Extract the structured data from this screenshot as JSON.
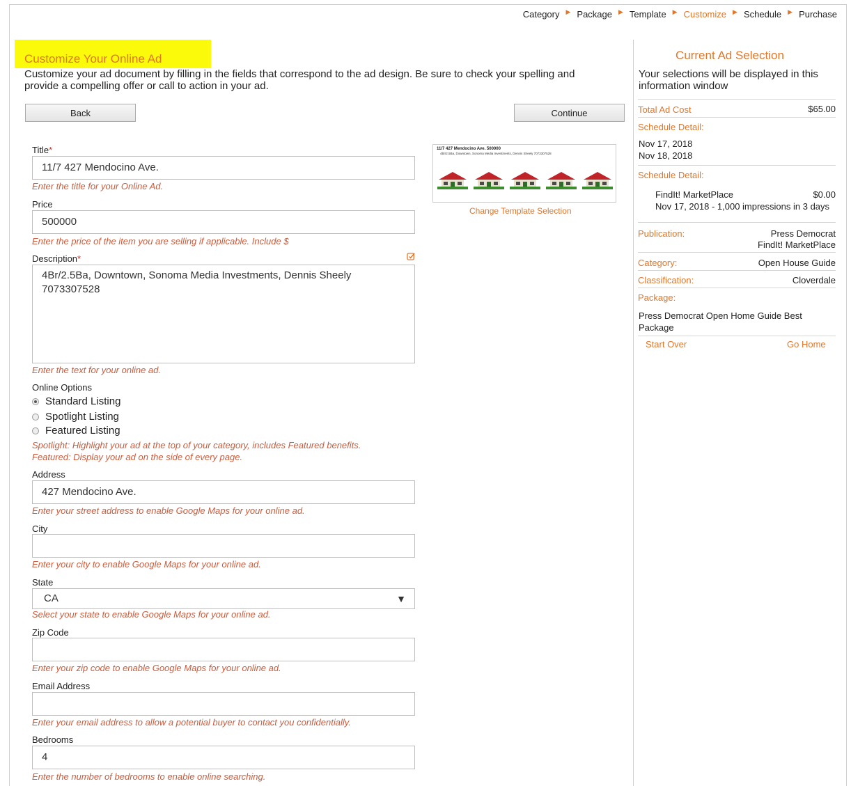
{
  "breadcrumb": [
    {
      "label": "Category",
      "active": false
    },
    {
      "label": "Package",
      "active": false
    },
    {
      "label": "Template",
      "active": false
    },
    {
      "label": "Customize",
      "active": true
    },
    {
      "label": "Schedule",
      "active": false
    },
    {
      "label": "Purchase",
      "active": false
    }
  ],
  "page": {
    "title": "Customize Your Online Ad",
    "intro": "Customize your ad document by filling in the fields that correspond to the ad design. Be sure to check your spelling and provide a compelling offer or call to action in your ad."
  },
  "buttons": {
    "back": "Back",
    "continue": "Continue"
  },
  "form": {
    "title": {
      "label": "Title",
      "req": "*",
      "value": "11/7 427 Mendocino Ave.",
      "hint": "Enter the title for your Online Ad."
    },
    "price": {
      "label": "Price",
      "value": "500000",
      "hint": "Enter the price of the item you are selling if applicable. Include $"
    },
    "description": {
      "label": "Description",
      "req": "*",
      "value": "4Br/2.5Ba, Downtown, Sonoma Media Investments, Dennis Sheely 7073307528",
      "hint": "Enter the text for your online ad."
    },
    "online_options": {
      "label": "Online Options",
      "options": [
        "Standard Listing",
        "Spotlight Listing",
        "Featured Listing"
      ],
      "selected": "Standard Listing",
      "hint1": "Spotlight: Highlight your ad at the top of your category, includes Featured benefits.",
      "hint2": "Featured: Display your ad on the side of every page."
    },
    "address": {
      "label": "Address",
      "value": "427 Mendocino Ave.",
      "hint": "Enter your street address to enable Google Maps for your online ad."
    },
    "city": {
      "label": "City",
      "value": "",
      "hint": "Enter your city to enable Google Maps for your online ad."
    },
    "state": {
      "label": "State",
      "value": "CA",
      "arrow": "▼",
      "hint": "Select your state to enable Google Maps for your online ad."
    },
    "zip": {
      "label": "Zip Code",
      "value": "",
      "hint": "Enter your zip code to enable Google Maps for your online ad."
    },
    "email": {
      "label": "Email Address",
      "value": "",
      "hint": "Enter your email address to allow a potential buyer to contact you confidentially."
    },
    "bedrooms": {
      "label": "Bedrooms",
      "value": "4",
      "hint": "Enter the number of bedrooms to enable online searching."
    }
  },
  "preview": {
    "title": "11/7 427 Mendocino Ave.        500000",
    "sub": "4Br/2.5Ba, Downtown, Sonoma Media Investments, Dennis Sheely 7073307528",
    "change_link": "Change Template Selection"
  },
  "sidebar": {
    "title": "Current Ad Selection",
    "intro": "Your selections will be displayed in this information window",
    "total_label": "Total Ad Cost",
    "total_value": "$65.00",
    "schedule_label_1": "Schedule Detail:",
    "dates": [
      "Nov 17, 2018",
      "Nov 18, 2018"
    ],
    "schedule_label_2": "Schedule Detail:",
    "item_name": "FindIt! MarketPlace",
    "item_price": "$0.00",
    "item_detail": "Nov 17, 2018 - 1,000 impressions in 3 days",
    "publication_label": "Publication:",
    "publication_values": [
      "Press Democrat",
      "FindIt! MarketPlace"
    ],
    "category_label": "Category:",
    "category_value": "Open House Guide",
    "classification_label": "Classification:",
    "classification_value": "Cloverdale",
    "package_label": "Package:",
    "package_value": "Press Democrat Open Home Guide Best Package",
    "start_over": "Start Over",
    "go_home": "Go Home"
  },
  "colors": {
    "accent": "#e0772c",
    "hint": "#cc5b3c",
    "highlight": "#fafa0a"
  }
}
